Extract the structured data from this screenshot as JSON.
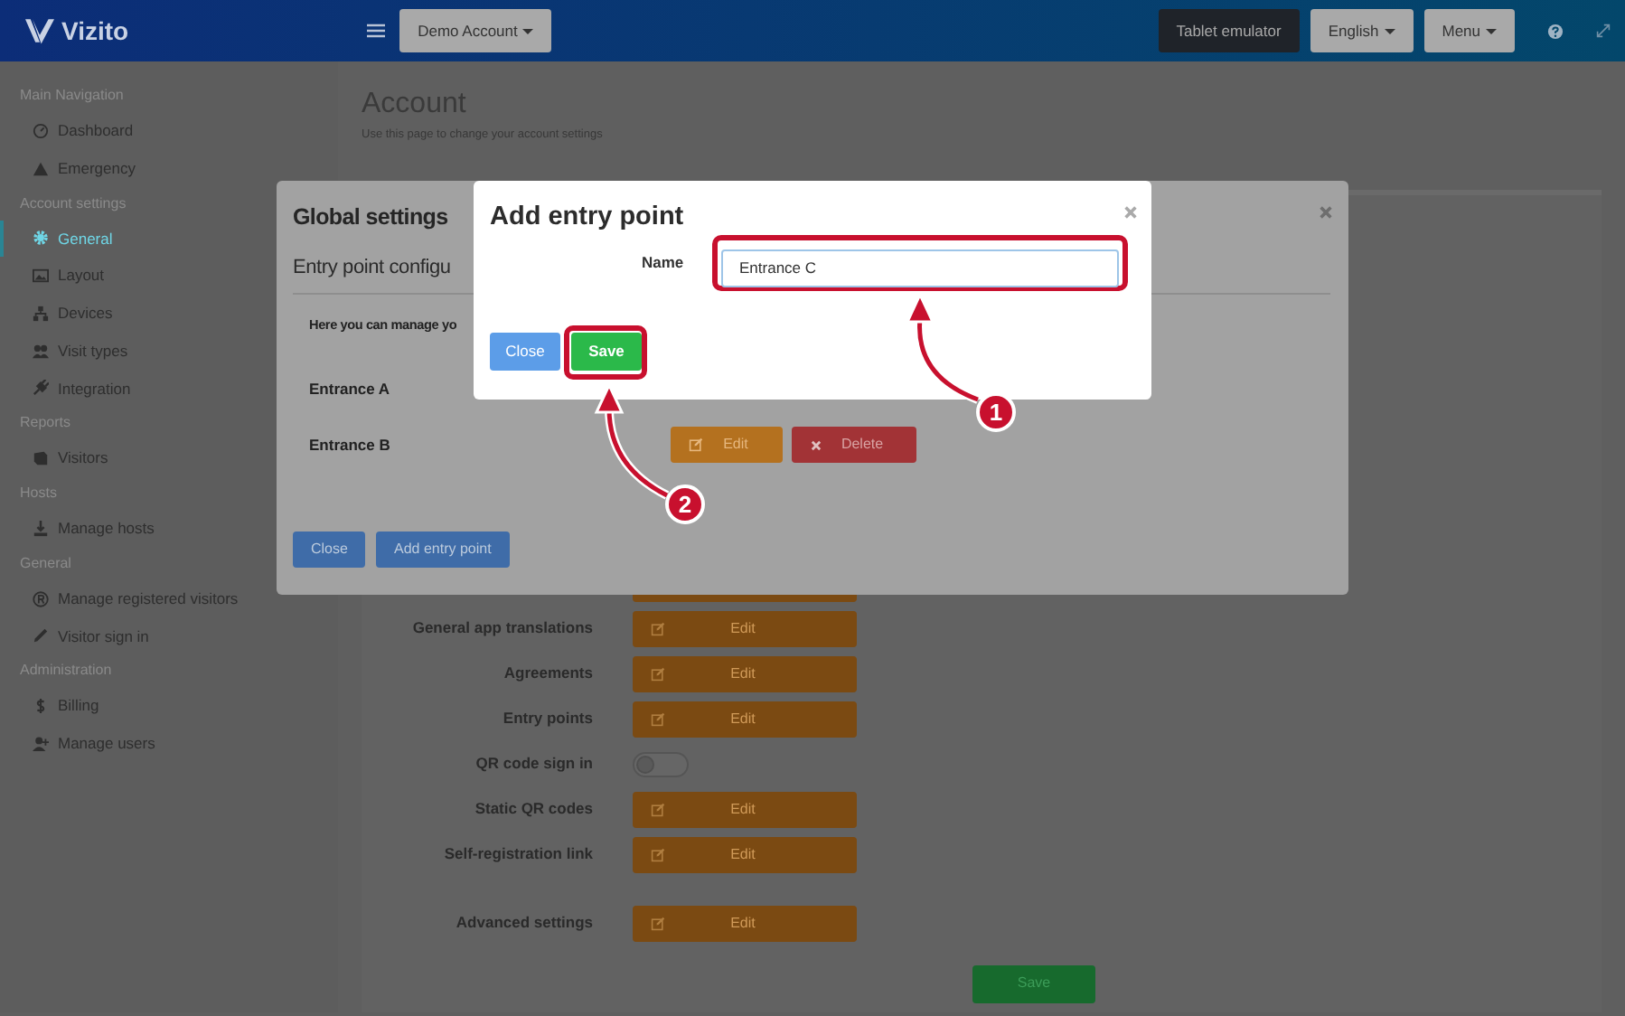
{
  "header": {
    "logo": "Vizito",
    "account_menu": "Demo Account",
    "buttons": [
      {
        "label": "Tablet emulator",
        "kind": "dark"
      },
      {
        "label": "English",
        "kind": "dropdown"
      },
      {
        "label": "Menu",
        "kind": "dropdown"
      }
    ]
  },
  "sidebar": {
    "sections": [
      {
        "title": "Main Navigation",
        "items": [
          {
            "label": "Dashboard",
            "selected": false
          },
          {
            "label": "Emergency",
            "selected": false
          }
        ]
      },
      {
        "title": "Account settings",
        "items": [
          {
            "label": "General",
            "selected": true
          },
          {
            "label": "Layout",
            "selected": false
          },
          {
            "label": "Devices",
            "selected": false
          },
          {
            "label": "Visit types",
            "selected": false
          },
          {
            "label": "Integration",
            "selected": false
          }
        ]
      },
      {
        "title": "Reports",
        "items": [
          {
            "label": "Visitors",
            "selected": false
          }
        ]
      },
      {
        "title": "Hosts",
        "items": [
          {
            "label": "Manage hosts",
            "selected": false
          }
        ]
      },
      {
        "title": "General",
        "items": [
          {
            "label": "Manage registered visitors",
            "selected": false
          },
          {
            "label": "Visitor sign in",
            "selected": false
          }
        ]
      },
      {
        "title": "Administration",
        "items": [
          {
            "label": "Billing",
            "selected": false
          },
          {
            "label": "Manage users",
            "selected": false
          }
        ]
      }
    ]
  },
  "page": {
    "title": "Account",
    "subtitle": "Use this page to change your account settings",
    "settings": [
      {
        "label": "General app translations",
        "kind": "edit",
        "button": "Edit"
      },
      {
        "label": "Agreements",
        "kind": "edit",
        "button": "Edit"
      },
      {
        "label": "Entry points",
        "kind": "edit",
        "button": "Edit"
      },
      {
        "label": "QR code sign in",
        "kind": "toggle",
        "on": false
      },
      {
        "label": "Static QR codes",
        "kind": "edit",
        "button": "Edit"
      },
      {
        "label": "Self-registration link",
        "kind": "edit",
        "button": "Edit"
      },
      {
        "label": "Advanced settings",
        "kind": "edit",
        "button": "Edit",
        "separated": true
      }
    ],
    "save_button": "Save"
  },
  "global_settings_dialog": {
    "title": "Global settings",
    "subtitle": "Entry point configu",
    "intro": "Here you can manage yo",
    "entries": [
      {
        "name": "Entrance A"
      },
      {
        "name": "Entrance B",
        "edit_button": "Edit",
        "delete_button": "Delete"
      }
    ],
    "buttons": [
      "Close",
      "Add entry point"
    ]
  },
  "add_entry_dialog": {
    "title": "Add entry point",
    "field_label": "Name",
    "field_value": "Entrance C",
    "field_highlighted": true,
    "buttons": [
      {
        "label": "Close",
        "kind": "secondary",
        "highlighted": false
      },
      {
        "label": "Save",
        "kind": "primary",
        "highlighted": true
      }
    ]
  },
  "annotations": [
    {
      "number": "1"
    },
    {
      "number": "2"
    }
  ]
}
